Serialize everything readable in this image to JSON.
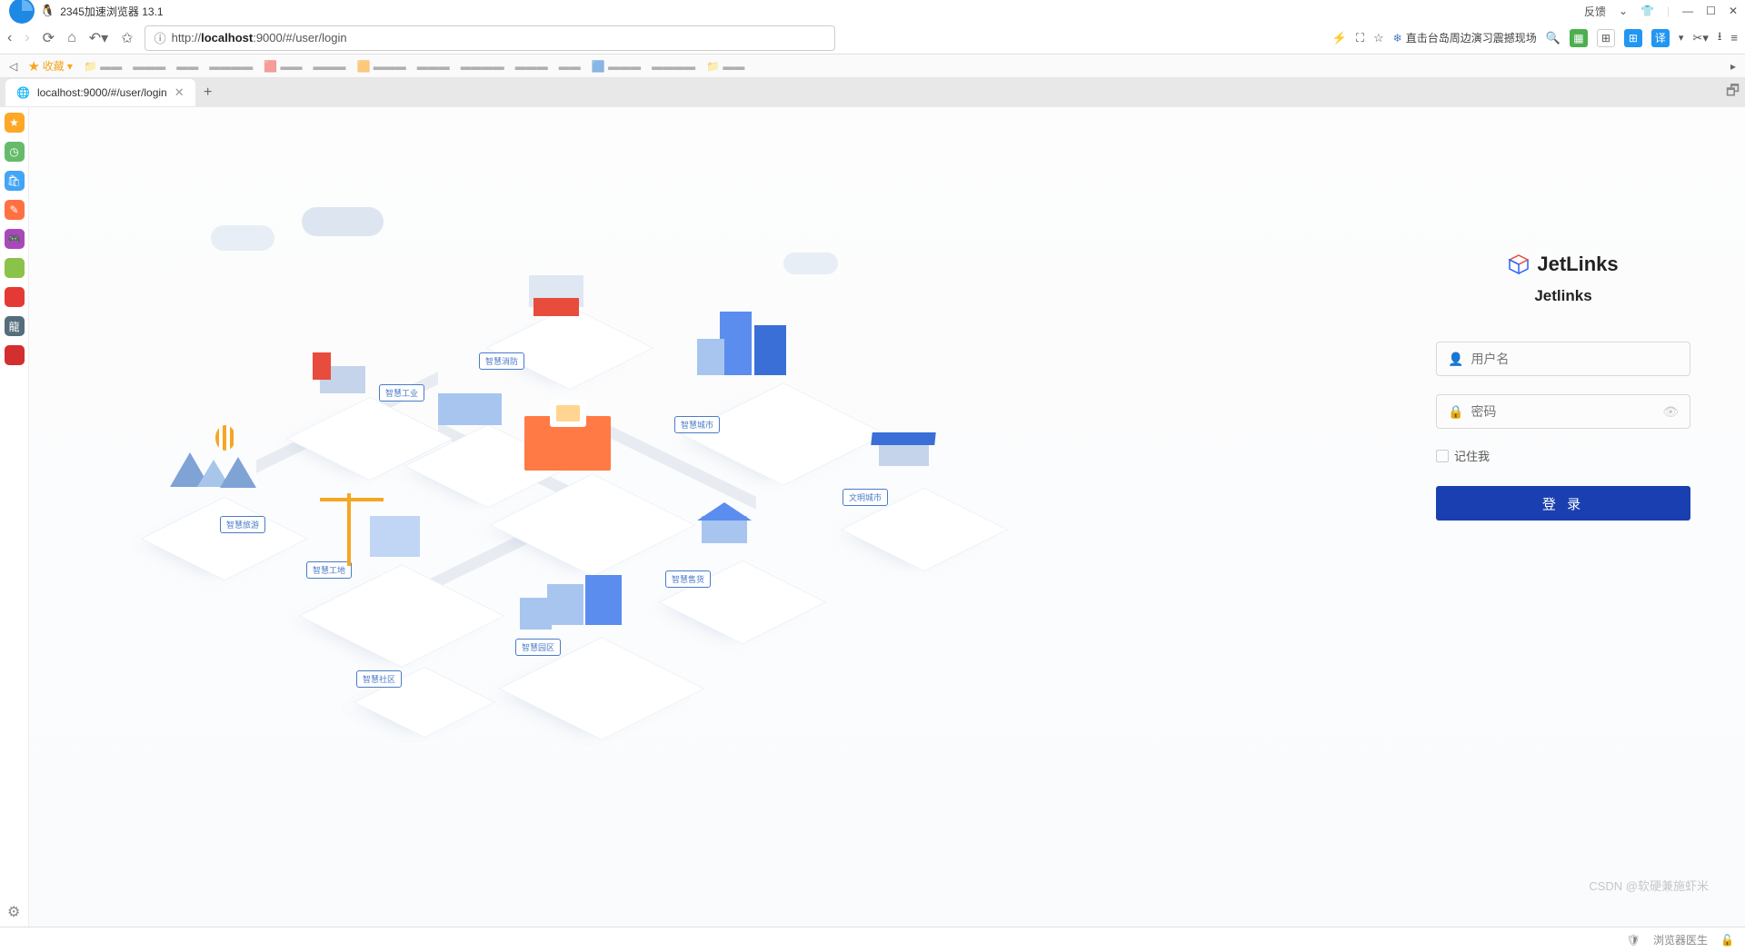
{
  "browser": {
    "title": "2345加速浏览器 13.1",
    "feedback": "反馈",
    "url_prefix": "http://",
    "url_host": "localhost",
    "url_path": ":9000/#/user/login",
    "news_text": "直击台岛周边演习震撼现场",
    "favorites_label": "收藏"
  },
  "tab": {
    "title": "localhost:9000/#/user/login"
  },
  "login": {
    "brand": "JetLinks",
    "subtitle": "Jetlinks",
    "username_placeholder": "用户名",
    "password_placeholder": "密码",
    "remember_label": "记住我",
    "login_button": "登 录"
  },
  "illustration": {
    "signs": [
      "智慧消防",
      "智慧工业",
      "智慧城市",
      "智慧工地",
      "智慧社区",
      "智慧旅游",
      "智慧售货",
      "智慧园区",
      "文明城市"
    ]
  },
  "status": {
    "doctor": "浏览器医生",
    "watermark": "CSDN @软硬兼施虾米"
  }
}
